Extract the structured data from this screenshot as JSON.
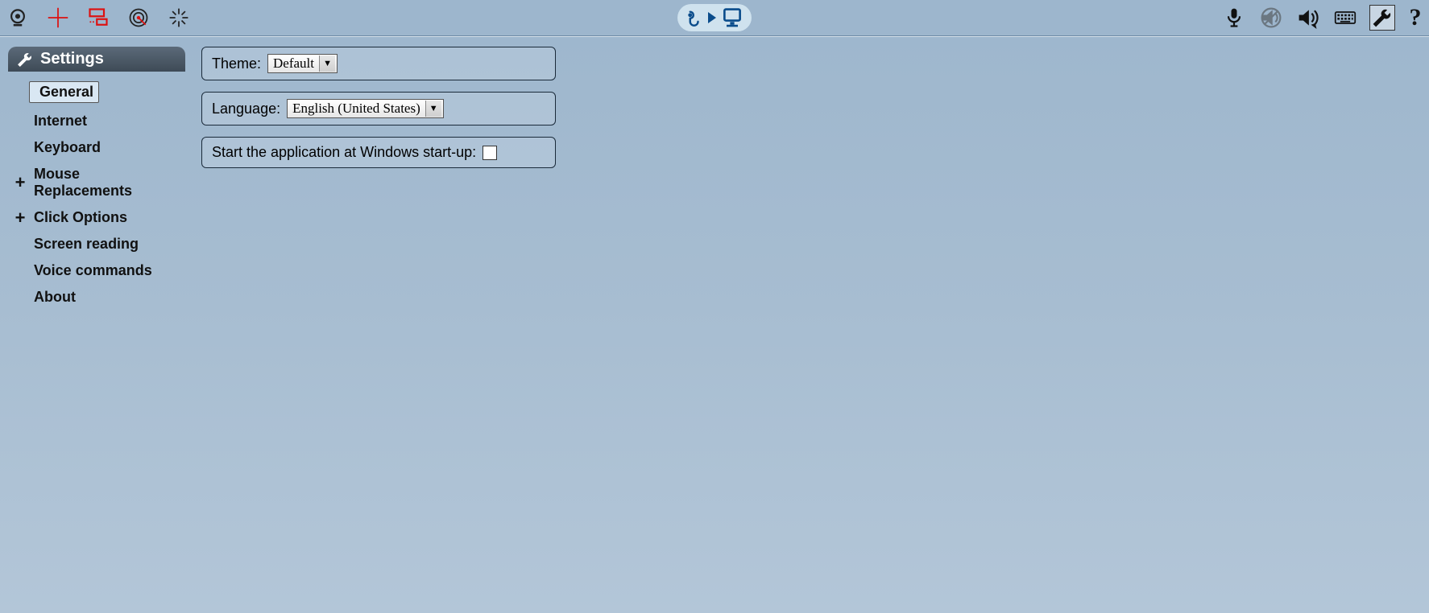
{
  "toolbar": {
    "left_icons": [
      "camera-icon",
      "crosshair-icon",
      "rectangle-icon",
      "radar-icon",
      "burst-icon"
    ],
    "right_icons": [
      "microphone-icon",
      "voice-off-icon",
      "volume-icon",
      "keyboard-icon",
      "wrench-icon",
      "help-icon"
    ]
  },
  "sidebar": {
    "title": "Settings",
    "items": [
      {
        "label": "General",
        "expandable": false,
        "selected": true,
        "indent": 1
      },
      {
        "label": "Internet",
        "expandable": false,
        "selected": false,
        "indent": 1
      },
      {
        "label": "Keyboard",
        "expandable": false,
        "selected": false,
        "indent": 1
      },
      {
        "label": "Mouse Replacements",
        "expandable": true,
        "selected": false,
        "indent": 0
      },
      {
        "label": "Click Options",
        "expandable": true,
        "selected": false,
        "indent": 0
      },
      {
        "label": "Screen reading",
        "expandable": false,
        "selected": false,
        "indent": 1
      },
      {
        "label": "Voice commands",
        "expandable": false,
        "selected": false,
        "indent": 1
      },
      {
        "label": "About",
        "expandable": false,
        "selected": false,
        "indent": 1
      }
    ]
  },
  "settings": {
    "theme_label": "Theme:",
    "theme_value": "Default",
    "language_label": "Language:",
    "language_value": "English (United States)",
    "startup_label": "Start the application at Windows start-up:",
    "startup_checked": false
  },
  "help_symbol": "?"
}
